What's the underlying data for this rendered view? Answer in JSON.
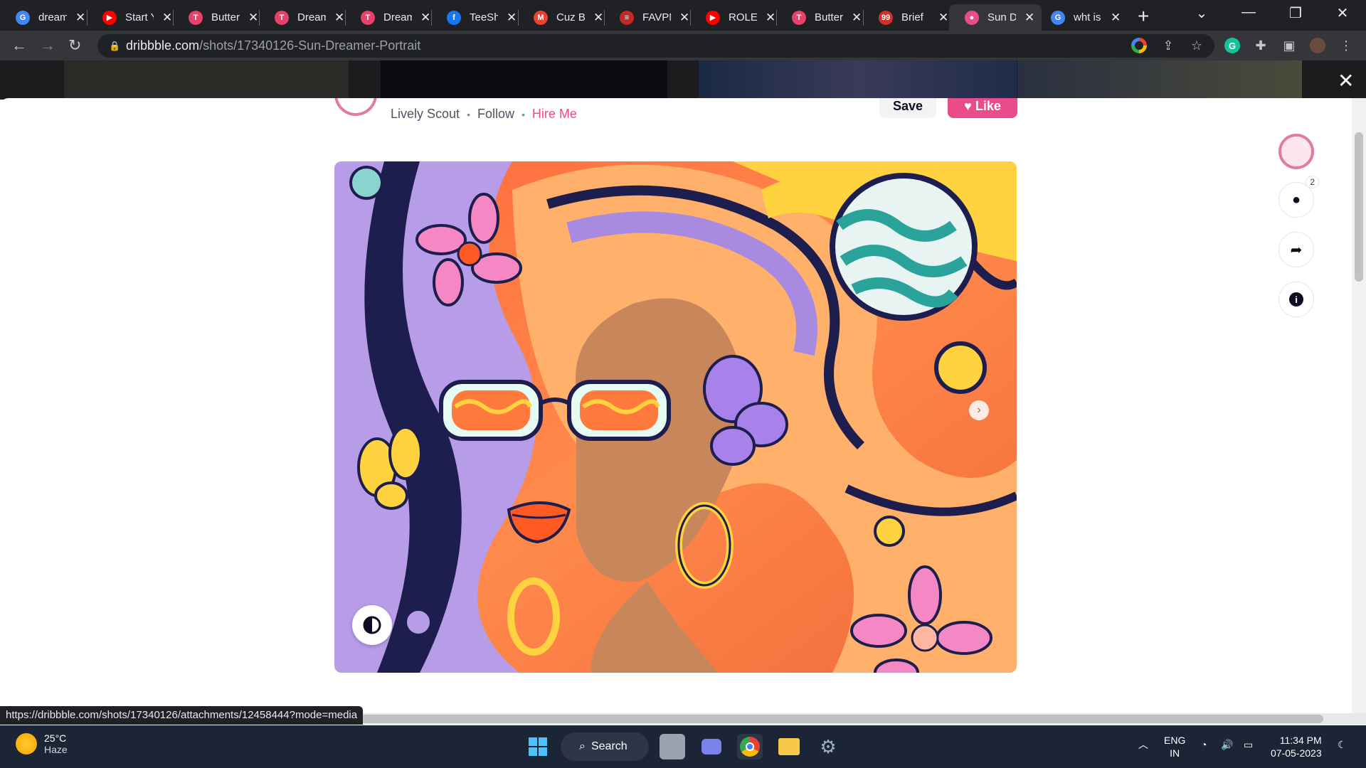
{
  "browser": {
    "tabs": [
      {
        "title": "dream",
        "favicon_color": "#4285f4",
        "favicon_glyph": "G"
      },
      {
        "title": "Start Y",
        "favicon_color": "#ff0000",
        "favicon_glyph": "▶"
      },
      {
        "title": "Butter",
        "favicon_color": "#e8426b",
        "favicon_glyph": "T"
      },
      {
        "title": "Dream",
        "favicon_color": "#e8426b",
        "favicon_glyph": "T"
      },
      {
        "title": "Dream",
        "favicon_color": "#e8426b",
        "favicon_glyph": "T"
      },
      {
        "title": "TeeSh",
        "favicon_color": "#1877f2",
        "favicon_glyph": "f"
      },
      {
        "title": "Cuz B",
        "favicon_color": "#ea4335",
        "favicon_glyph": "M"
      },
      {
        "title": "FAVPN",
        "favicon_color": "#c62828",
        "favicon_glyph": "≡"
      },
      {
        "title": "ROLE",
        "favicon_color": "#ff0000",
        "favicon_glyph": "▶"
      },
      {
        "title": "Butter",
        "favicon_color": "#e8426b",
        "favicon_glyph": "T"
      },
      {
        "title": "Brief",
        "favicon_color": "#d32f2f",
        "favicon_glyph": "99"
      },
      {
        "title": "Sun D",
        "favicon_color": "#ea4c89",
        "favicon_glyph": "●",
        "active": true
      },
      {
        "title": "wht is",
        "favicon_color": "#4285f4",
        "favicon_glyph": "G"
      }
    ],
    "new_tab_label": "+",
    "url_domain": "dribbble.com",
    "url_path": "/shots/17340126-Sun-Dreamer-Portrait",
    "status_url": "https://dribbble.com/shots/17340126/attachments/12458444?mode=media"
  },
  "shot": {
    "author": "Lively Scout",
    "follow_label": "Follow",
    "hire_label": "Hire Me",
    "save_label": "Save",
    "like_label": "Like",
    "comment_count": "2",
    "colors": {
      "accent": "#ea4c89",
      "text": "#515162"
    }
  },
  "taskbar": {
    "weather_temp": "25°C",
    "weather_desc": "Haze",
    "search_label": "Search",
    "lang_top": "ENG",
    "lang_bottom": "IN",
    "time": "11:34 PM",
    "date": "07-05-2023"
  }
}
